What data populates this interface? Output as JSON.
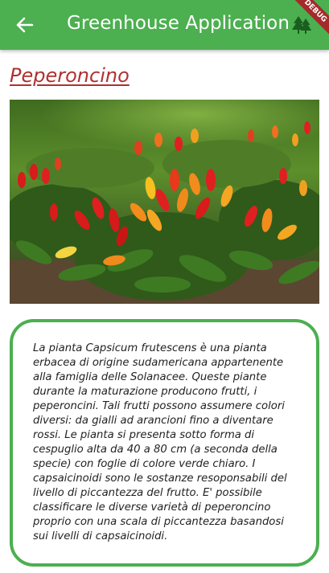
{
  "appbar": {
    "title": "Greenhouse Application",
    "back_icon": "arrow-left-icon",
    "action_icon": "pine-tree-icon",
    "color": "#4caf50"
  },
  "debug_banner": {
    "label": "DEBUG"
  },
  "plant": {
    "name": "Peperoncino",
    "name_color": "#b03030",
    "image_alt": "Peperoncino plants",
    "description": "La pianta Capsicum frutescens è una pianta erbacea di origine sudamericana appartenente alla famiglia delle Solanacee. Queste piante durante la maturazione producono frutti, i peperoncini. Tali frutti possono assumere colori diversi: da gialli ad arancioni fino a diventare rossi. Le pianta si presenta sotto forma di cespuglio alta da 40 a 80 cm (a seconda della specie) con foglie di colore verde chiaro. I capsaicinoidi sono le sostanze resoponsabili del livello di piccantezza del frutto. E' possibile classificare le diverse varietà di peperoncino proprio con una scala di piccantezza basandosi sui livelli di capsaicinoidi."
  }
}
